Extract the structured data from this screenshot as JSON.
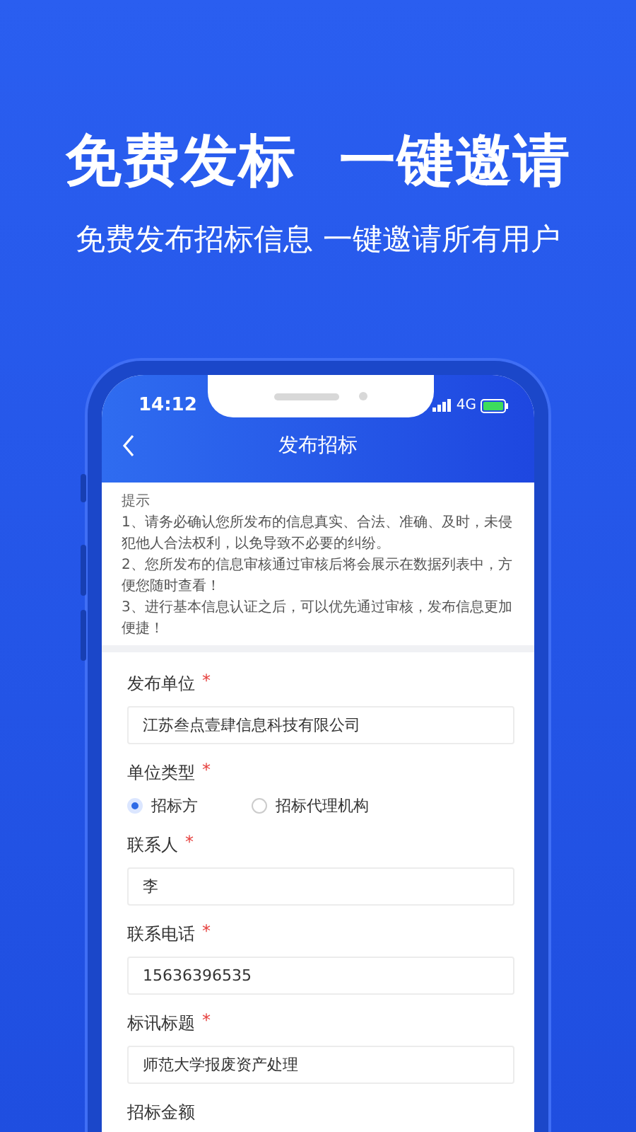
{
  "headline": "免费发标  一键邀请",
  "subheadline": "免费发布招标信息 一键邀请所有用户",
  "status_bar": {
    "time": "14:12",
    "network": "4G"
  },
  "nav": {
    "title": "发布招标"
  },
  "notice": {
    "title": "提示",
    "lines": [
      "1、请务必确认您所发布的信息真实、合法、准确、及时，未侵犯他人合法权利，以免导致不必要的纠纷。",
      "2、您所发布的信息审核通过审核后将会展示在数据列表中，方便您随时查看！",
      "3、进行基本信息认证之后，可以优先通过审核，发布信息更加便捷！"
    ]
  },
  "form": [
    {
      "kind": "text",
      "label": "发布单位",
      "required_mark": "*",
      "value": "江苏叁点壹肆信息科技有限公司"
    },
    {
      "kind": "radio",
      "label": "单位类型",
      "required_mark": "*",
      "options": [
        {
          "label": "招标方",
          "selected": true
        },
        {
          "label": "招标代理机构",
          "selected": false
        }
      ]
    },
    {
      "kind": "text",
      "label": "联系人",
      "required_mark": "*",
      "value": "李"
    },
    {
      "kind": "text",
      "label": "联系电话",
      "required_mark": "*",
      "value": "15636396535"
    },
    {
      "kind": "text",
      "label": "标讯标题",
      "required_mark": "*",
      "value": "师范大学报废资产处理"
    },
    {
      "kind": "label",
      "label": "招标金额"
    }
  ]
}
